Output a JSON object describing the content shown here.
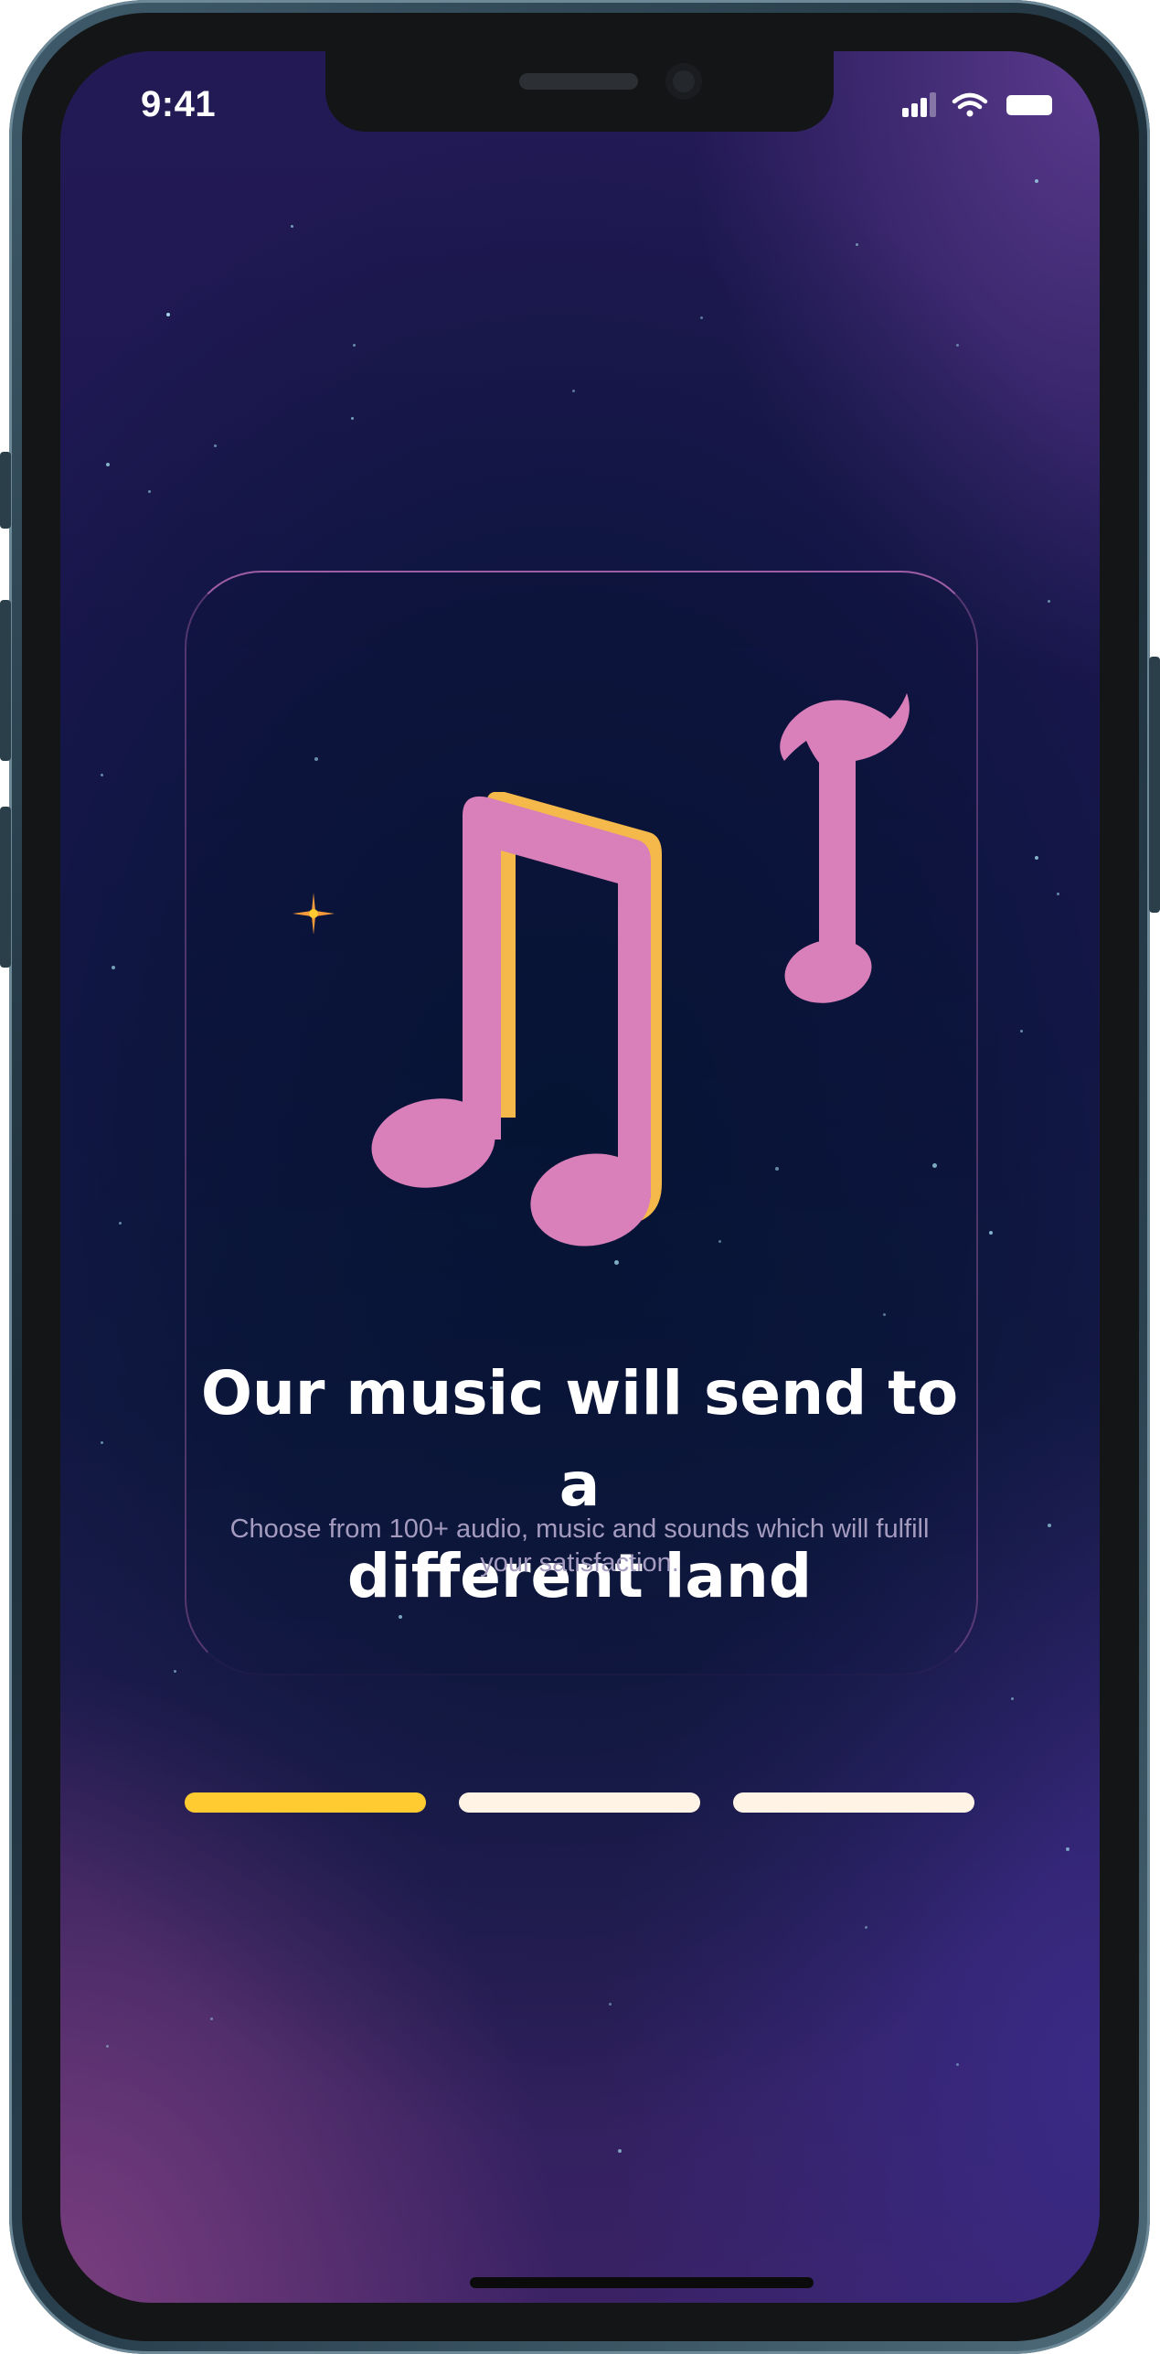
{
  "status_bar": {
    "time": "9:41",
    "icons": [
      "signal-icon",
      "wifi-icon",
      "battery-icon"
    ]
  },
  "onboarding": {
    "title": "Our music will send to a different land",
    "title_line1": "Our music will send to a",
    "title_line2": "different land",
    "description": "Choose from 100+ audio, music and sounds which will fulfill your satisfaction.",
    "illustration_icons": [
      "music-note-pair-icon",
      "music-note-icon",
      "sparkle-icon"
    ]
  },
  "pagination": {
    "total_steps": 3,
    "active_step": 1
  },
  "colors": {
    "accent": "#ffcb30",
    "note_pink": "#d97fba",
    "note_shadow": "#f5b84a",
    "inactive_step": "#fff3e6",
    "background_deep": "#061535",
    "background_purple": "#5b3a8e"
  }
}
